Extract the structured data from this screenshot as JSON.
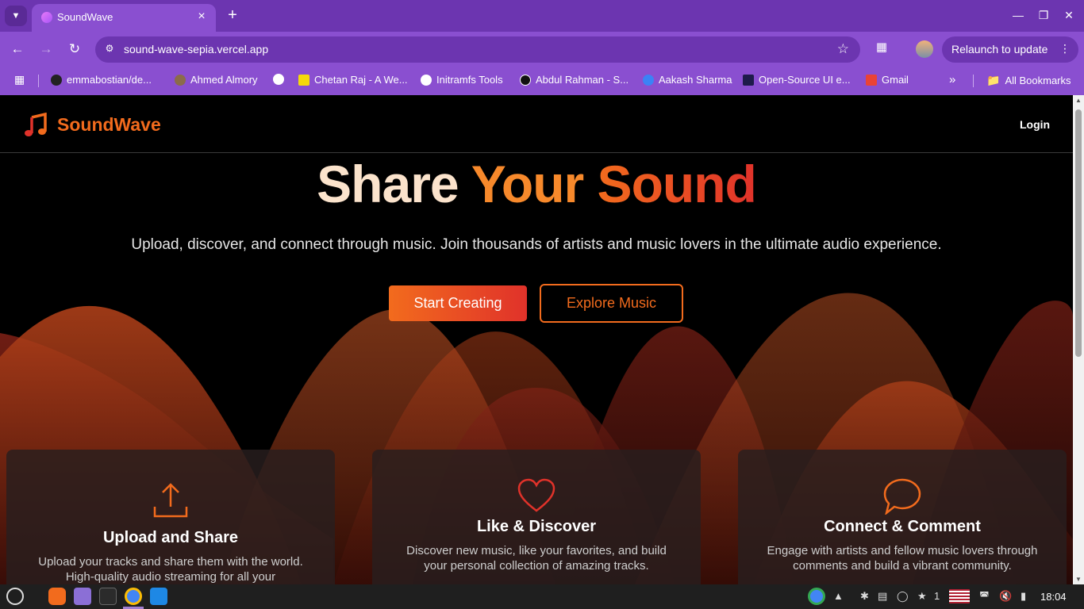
{
  "browser": {
    "tab_title": "SoundWave",
    "url": "sound-wave-sepia.vercel.app",
    "relaunch_label": "Relaunch to update",
    "bookmarks": [
      {
        "label": "emmabostian/de..."
      },
      {
        "label": "Ahmed Almory"
      },
      {
        "label": ""
      },
      {
        "label": "Chetan Raj - A We..."
      },
      {
        "label": "Initramfs Tools"
      },
      {
        "label": "Abdul Rahman - S..."
      },
      {
        "label": "Aakash Sharma"
      },
      {
        "label": "Open-Source UI e..."
      },
      {
        "label": "Gmail"
      }
    ],
    "all_bookmarks_label": "All Bookmarks"
  },
  "site": {
    "logo_text": "SoundWave",
    "login_label": "Login",
    "hero": {
      "title_part1": "Share",
      "title_part2": "Your",
      "title_part3": "Sound",
      "subtitle": "Upload, discover, and connect through music. Join thousands of artists and music lovers in the ultimate audio experience.",
      "primary_button": "Start Creating",
      "secondary_button": "Explore Music"
    },
    "features": [
      {
        "icon": "upload-icon",
        "title": "Upload and Share",
        "description": "Upload your tracks and share them with the world. High-quality audio streaming for all your"
      },
      {
        "icon": "heart-icon",
        "title": "Like & Discover",
        "description": "Discover new music, like your favorites, and build your personal collection of amazing tracks."
      },
      {
        "icon": "chat-icon",
        "title": "Connect & Comment",
        "description": "Engage with artists and fellow music lovers through comments and build a vibrant community."
      }
    ],
    "colors": {
      "accent": "#f26b1d",
      "accent_red": "#e0322a",
      "background": "#000000"
    }
  },
  "taskbar": {
    "tray_count": "1",
    "clock": "18:04"
  }
}
